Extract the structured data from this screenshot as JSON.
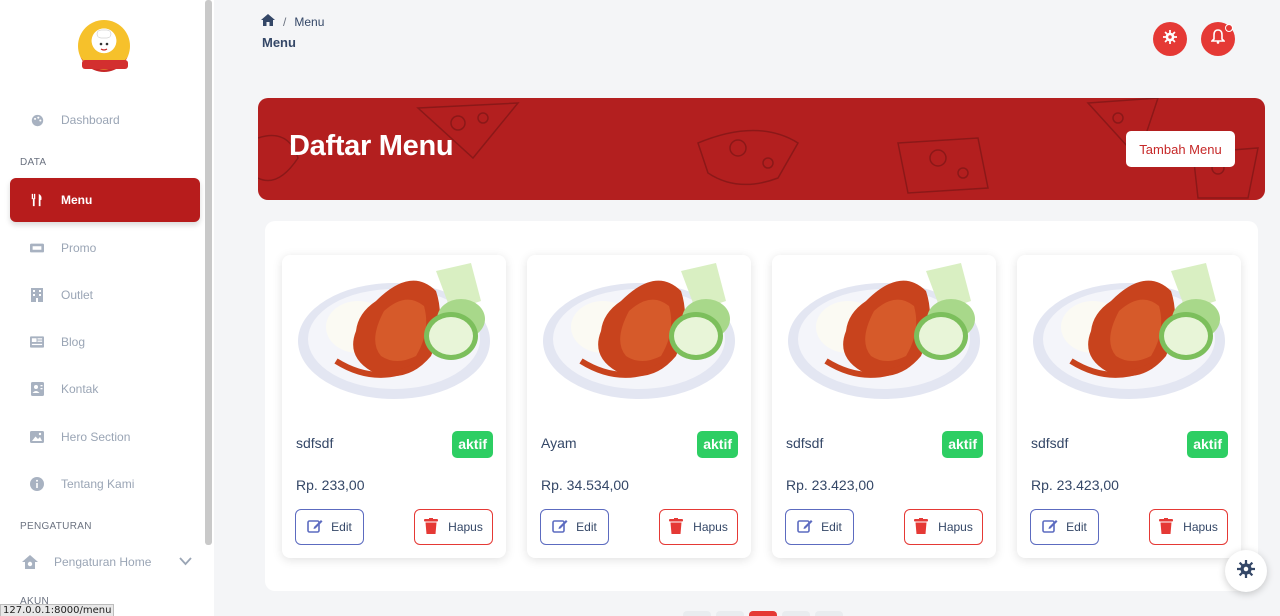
{
  "sidebar": {
    "items": [
      {
        "label": "Dashboard",
        "icon": "palette-icon"
      },
      {
        "label": "Menu",
        "icon": "utensils-icon"
      },
      {
        "label": "Promo",
        "icon": "ticket-icon"
      },
      {
        "label": "Outlet",
        "icon": "building-icon"
      },
      {
        "label": "Blog",
        "icon": "newspaper-icon"
      },
      {
        "label": "Kontak",
        "icon": "contact-icon"
      },
      {
        "label": "Hero Section",
        "icon": "image-icon"
      },
      {
        "label": "Tentang Kami",
        "icon": "info-icon"
      },
      {
        "label": "Pengaturan Home",
        "icon": "home-settings-icon"
      }
    ],
    "sections": {
      "data": "DATA",
      "pengaturan": "PENGATURAN",
      "akun": "AKUN"
    }
  },
  "status_url": "127.0.0.1:8000/menu",
  "header": {
    "breadcrumb_current": "Menu",
    "title": "Menu"
  },
  "banner": {
    "title": "Daftar Menu",
    "add_button": "Tambah Menu"
  },
  "colors": {
    "primary": "#b31f1f",
    "accent": "#e53935",
    "success": "#2dce63"
  },
  "cards": [
    {
      "name": "sdfsdf",
      "status": "aktif",
      "price": "Rp. 233,00",
      "edit": "Edit",
      "delete": "Hapus"
    },
    {
      "name": "Ayam",
      "status": "aktif",
      "price": "Rp. 34.534,00",
      "edit": "Edit",
      "delete": "Hapus"
    },
    {
      "name": "sdfsdf",
      "status": "aktif",
      "price": "Rp. 23.423,00",
      "edit": "Edit",
      "delete": "Hapus"
    },
    {
      "name": "sdfsdf",
      "status": "aktif",
      "price": "Rp. 23.423,00",
      "edit": "Edit",
      "delete": "Hapus"
    }
  ]
}
